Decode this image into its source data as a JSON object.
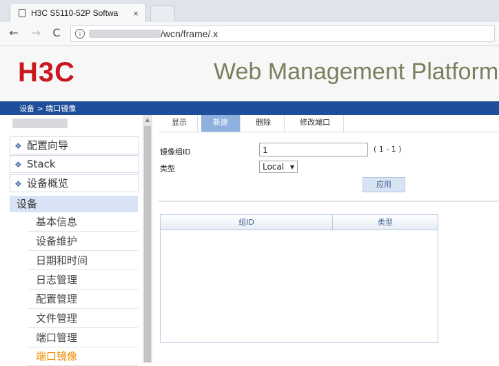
{
  "browser": {
    "tab_title": "H3C S5110-52P Softwa",
    "tab_close": "×",
    "url_text": "/wcn/frame/.x",
    "info_glyph": "i",
    "back_glyph": "←",
    "forward_glyph": "→",
    "reload_glyph": "C"
  },
  "header": {
    "logo": "H3C",
    "platform_title": "Web Management Platform",
    "breadcrumb": "设备 > 端口镜像"
  },
  "sidebar": {
    "scroll_up": "▲",
    "top_items": [
      {
        "label": "配置向导",
        "icon": "diamond-icon"
      },
      {
        "label": "Stack",
        "icon": "diamond-icon"
      },
      {
        "label": "设备概览",
        "icon": "diamond-icon"
      }
    ],
    "section": "设备",
    "sub_items": [
      "基本信息",
      "设备维护",
      "日期和时间",
      "日志管理",
      "配置管理",
      "文件管理",
      "端口管理",
      "端口镜像"
    ],
    "active_index": 7
  },
  "main": {
    "tabs": [
      "显示",
      "新建",
      "删除",
      "修改端口"
    ],
    "selected_tab": 1,
    "form": {
      "group_id_label": "镜像组ID",
      "group_id_value": "1",
      "group_id_range": "( 1 - 1 )",
      "type_label": "类型",
      "type_value": "Local",
      "apply_label": "应用"
    },
    "table": {
      "columns": [
        "组ID",
        "类型"
      ]
    }
  },
  "colors": {
    "brand_red": "#c8171f",
    "nav_blue": "#1f4f9a",
    "selected_tab": "#8db0de",
    "active_menu": "#f08c00"
  }
}
